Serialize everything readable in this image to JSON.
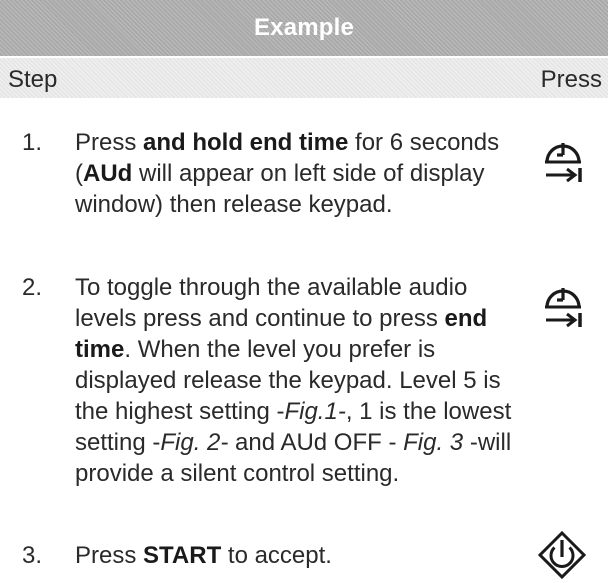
{
  "title": "Example",
  "header": {
    "step": "Step",
    "press": "Press"
  },
  "steps": [
    {
      "number": "1.",
      "text": [
        "Press ",
        "and hold end time",
        " for 6 seconds (",
        "AUd",
        " will appear on left side of display window) then release keypad."
      ],
      "press_icon": "end-time-icon"
    },
    {
      "number": "2.",
      "text": [
        "To toggle through the available audio levels press and continue to press ",
        "end time",
        ". When the level you prefer is displayed release the keypad. Level 5 is the highest setting -",
        "Fig.1-",
        ", 1 is the lowest setting -",
        "Fig. 2-",
        " and AUd OFF - ",
        "Fig. 3",
        " -will provide a silent control setting."
      ],
      "press_icon": "end-time-icon"
    },
    {
      "number": "3.",
      "text": [
        "Press ",
        "START",
        " to accept."
      ],
      "press_icon": "start-icon"
    }
  ]
}
